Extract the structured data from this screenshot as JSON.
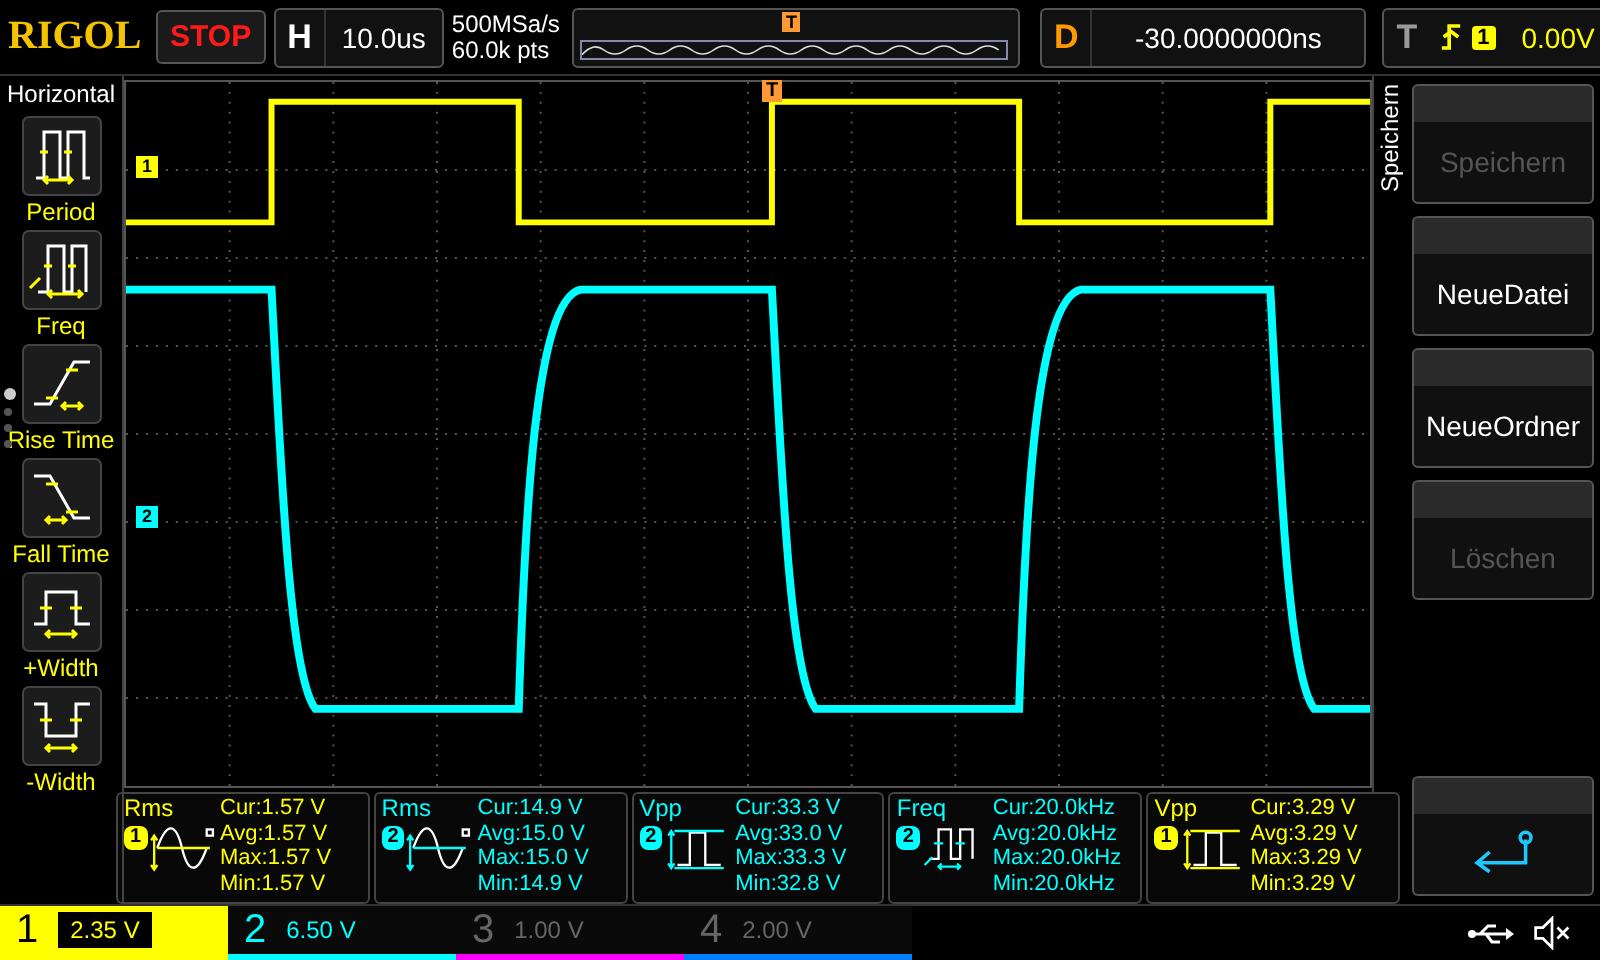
{
  "header": {
    "logo": "RIGOL",
    "run_state": "STOP",
    "timebase": {
      "label": "H",
      "value": "10.0us"
    },
    "sample_rate": "500MSa/s",
    "memory_depth": "60.0k pts",
    "overview_trigger": "T",
    "delay": {
      "label": "D",
      "value": "-30.0000000ns"
    },
    "trigger": {
      "label": "T",
      "source": "1",
      "level": "0.00V"
    }
  },
  "sidebar": {
    "title": "Horizontal",
    "items": [
      {
        "kind": "period",
        "label": "Period"
      },
      {
        "kind": "freq",
        "label": "Freq"
      },
      {
        "kind": "rise",
        "label": "Rise Time"
      },
      {
        "kind": "fall",
        "label": "Fall Time"
      },
      {
        "kind": "pwidth",
        "label": "+Width"
      },
      {
        "kind": "nwidth",
        "label": "-Width"
      }
    ],
    "pages": [
      {
        "selected": true
      },
      {
        "selected": false
      },
      {
        "selected": false
      },
      {
        "selected": false
      }
    ]
  },
  "screen": {
    "trigger_marker": "T",
    "channel_markers": [
      {
        "label": "1",
        "color": "#ffff00"
      },
      {
        "label": "2",
        "color": "#00ffff"
      }
    ]
  },
  "measurements": [
    {
      "kind": "rms",
      "name": "Rms",
      "channel": "1",
      "color": "#ffff00",
      "stats": [
        "Cur:1.57 V",
        "Avg:1.57 V",
        "Max:1.57 V",
        "Min:1.57 V"
      ]
    },
    {
      "kind": "rms",
      "name": "Rms",
      "channel": "2",
      "color": "#00ffff",
      "stats": [
        "Cur:14.9 V",
        "Avg:15.0 V",
        "Max:15.0 V",
        "Min:14.9 V"
      ]
    },
    {
      "kind": "vpp",
      "name": "Vpp",
      "channel": "2",
      "color": "#00ffff",
      "stats": [
        "Cur:33.3 V",
        "Avg:33.0 V",
        "Max:33.3 V",
        "Min:32.8 V"
      ]
    },
    {
      "kind": "freq",
      "name": "Freq",
      "channel": "2",
      "color": "#00ffff",
      "stats": [
        "Cur:20.0kHz",
        "Avg:20.0kHz",
        "Max:20.0kHz",
        "Min:20.0kHz"
      ]
    },
    {
      "kind": "vpp",
      "name": "Vpp",
      "channel": "1",
      "color": "#ffff00",
      "stats": [
        "Cur:3.29 V",
        "Avg:3.29 V",
        "Max:3.29 V",
        "Min:3.29 V"
      ]
    }
  ],
  "menu": {
    "title": "Speichern",
    "buttons": [
      {
        "kind": "text",
        "label": "Speichern",
        "disabled": true
      },
      {
        "kind": "text",
        "label": "NeueDatei",
        "disabled": false
      },
      {
        "kind": "text",
        "label": "NeueOrdner",
        "disabled": false
      },
      {
        "kind": "text",
        "label": "Löschen",
        "disabled": true
      },
      {
        "kind": "return"
      }
    ]
  },
  "channels": [
    {
      "number": "1",
      "scale": "2.35 V",
      "on": true,
      "color": "#ffff00"
    },
    {
      "number": "2",
      "scale": "6.50 V",
      "on": true,
      "color": "#00ffff"
    },
    {
      "number": "3",
      "scale": "1.00 V",
      "on": false,
      "color": "#ff00ff"
    },
    {
      "number": "4",
      "scale": "2.00 V",
      "on": false,
      "color": "#0080ff"
    }
  ]
}
